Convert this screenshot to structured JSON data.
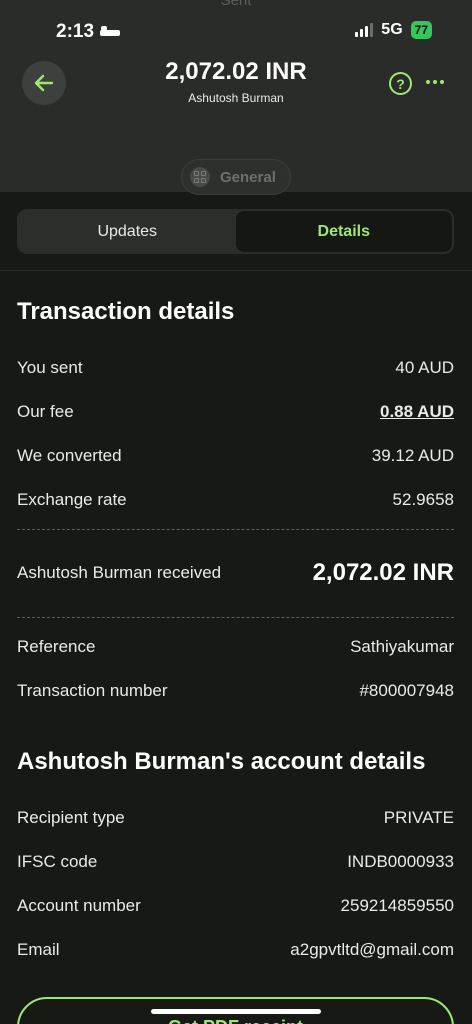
{
  "status_bar": {
    "time": "2:13",
    "network": "5G",
    "battery": "77"
  },
  "header": {
    "ghost_status": "Sent",
    "amount": "2,072.02 INR",
    "recipient": "Ashutosh Burman",
    "category": "General"
  },
  "tabs": [
    {
      "label": "Updates",
      "active": false
    },
    {
      "label": "Details",
      "active": true
    }
  ],
  "transaction": {
    "title": "Transaction details",
    "you_sent_label": "You sent",
    "you_sent_value": "40 AUD",
    "fee_label": "Our fee",
    "fee_value": "0.88 AUD",
    "converted_label": "We converted",
    "converted_value": "39.12 AUD",
    "rate_label": "Exchange rate",
    "rate_value": "52.9658",
    "received_label": "Ashutosh Burman received",
    "received_value": "2,072.02 INR",
    "reference_label": "Reference",
    "reference_value": "Sathiyakumar",
    "txn_number_label": "Transaction number",
    "txn_number_value": "#800007948"
  },
  "account": {
    "title": "Ashutosh Burman's account details",
    "recipient_type_label": "Recipient type",
    "recipient_type_value": "PRIVATE",
    "ifsc_label": "IFSC code",
    "ifsc_value": "INDB0000933",
    "account_number_label": "Account number",
    "account_number_value": "259214859550",
    "email_label": "Email",
    "email_value": "a2gpvtltd@gmail.com"
  },
  "pdf_button": "Get PDF receipt",
  "colors": {
    "accent": "#9fe870",
    "background": "#171915",
    "header_bg": "#2a2c29"
  }
}
